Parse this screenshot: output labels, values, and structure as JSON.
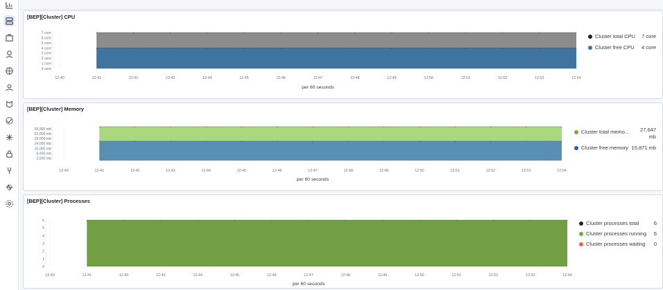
{
  "sidebar": {
    "icons": [
      "chart-icon",
      "dashboard-icon",
      "canvas-icon",
      "maps-icon",
      "ml-icon",
      "users-icon",
      "logs-icon",
      "uptime-icon",
      "apm-icon",
      "security-icon",
      "dev-tools-icon",
      "monitoring-icon",
      "settings-icon"
    ]
  },
  "colors": {
    "total_cpu": "#8c8c8c",
    "free_cpu": "#3f74a1",
    "total_memory": "#a9d87e",
    "free_memory": "#5a8fb4",
    "processes": "#739f44",
    "legend_black": "#222222",
    "legend_blue": "#3f74a1",
    "legend_green": "#6ab03a",
    "legend_red": "#e7664c"
  },
  "chart_data": [
    {
      "type": "area",
      "title": "[BEP][Cluster] CPU",
      "xlabel": "per 60 seconds",
      "x": [
        "12:40",
        "12:41",
        "12:42",
        "12:43",
        "12:44",
        "12:45",
        "12:46",
        "12:47",
        "12:48",
        "12:49",
        "12:50",
        "12:51",
        "12:52",
        "12:53",
        "12:54"
      ],
      "y_ticks": [
        "0 core",
        "1 core",
        "2 core",
        "3 core",
        "4 core",
        "5 core",
        "6 core",
        "7 core"
      ],
      "ylim": [
        0,
        7
      ],
      "data_range": [
        "12:41",
        "12:54"
      ],
      "series": [
        {
          "name": "Cluster total CPU",
          "value": 7,
          "display": "7 core"
        },
        {
          "name": "Cluster free CPU",
          "value": 4,
          "display": "4 core"
        }
      ]
    },
    {
      "type": "area",
      "title": "[BEP][Cluster] Memory",
      "xlabel": "per 60 seconds",
      "x": [
        "12:40",
        "12:41",
        "12:42",
        "12:43",
        "12:44",
        "12:45",
        "12:46",
        "12:47",
        "12:48",
        "12:49",
        "12:50",
        "12:51",
        "12:52",
        "12:53",
        "12:54"
      ],
      "y_ticks": [
        "2,000 mb",
        "6,000 mb",
        "10,000 mb",
        "14,000 mb",
        "18,000 mb",
        "22,000 mb",
        "26,000 mb"
      ],
      "ylim": [
        0,
        27647
      ],
      "data_range": [
        "12:41",
        "12:54"
      ],
      "series": [
        {
          "name": "Cluster total memo...",
          "value": 27647,
          "display": "27,647 mb"
        },
        {
          "name": "Cluster free memory",
          "value": 15871,
          "display": "15,871 mb"
        }
      ]
    },
    {
      "type": "area",
      "title": "[BEP][Cluster] Processes",
      "xlabel": "per 60 seconds",
      "x": [
        "12:40",
        "12:41",
        "12:42",
        "12:43",
        "12:44",
        "12:45",
        "12:46",
        "12:47",
        "12:48",
        "12:49",
        "12:50",
        "12:51",
        "12:52",
        "12:53",
        "12:54"
      ],
      "y_ticks": [
        "0",
        "1",
        "2",
        "3",
        "4",
        "5",
        "6"
      ],
      "ylim": [
        0,
        6
      ],
      "data_range": [
        "12:41",
        "12:54"
      ],
      "series": [
        {
          "name": "Cluster processes total",
          "value": 6,
          "display": "6"
        },
        {
          "name": "Cluster processes running",
          "value": 6,
          "display": "6"
        },
        {
          "name": "Cluster processes waiting",
          "value": 0,
          "display": "0"
        }
      ]
    }
  ]
}
